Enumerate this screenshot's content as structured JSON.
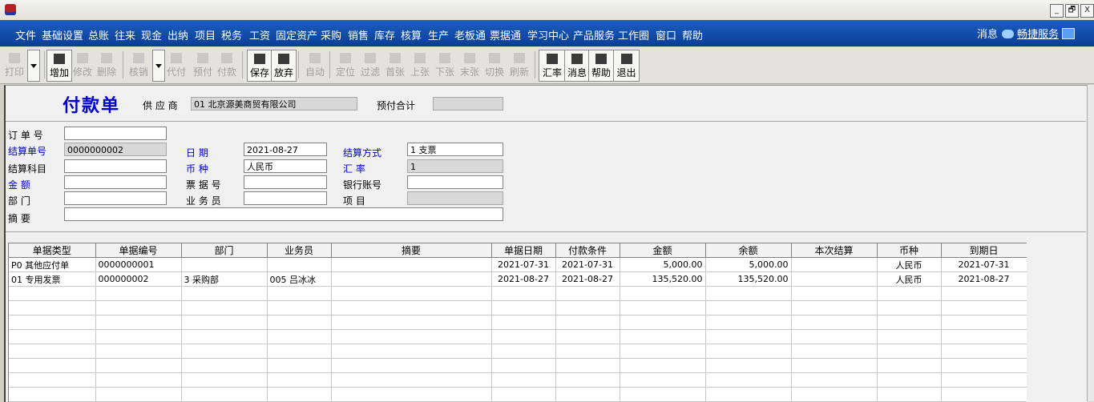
{
  "window": {
    "controls": [
      "_",
      "🗗",
      "X"
    ]
  },
  "menu": {
    "items": [
      "文件",
      "基础设置",
      "总账",
      "往来",
      "现金",
      "出纳",
      "项目",
      "税务",
      "工资",
      "固定资产",
      "采购",
      "销售",
      "库存",
      "核算",
      "生产",
      "老板通",
      "票据通",
      "学习中心",
      "产品服务",
      "工作圈",
      "窗口",
      "帮助"
    ],
    "messages": "消息",
    "service": "畅捷服务"
  },
  "toolbar": [
    {
      "label": "打印",
      "icon": "printer-icon",
      "enabled": false
    },
    {
      "label": "增加",
      "icon": "add-doc-icon",
      "enabled": true
    },
    {
      "label": "修改",
      "icon": "edit-icon",
      "enabled": false
    },
    {
      "label": "删除",
      "icon": "delete-x-icon",
      "enabled": false
    },
    {
      "label": "核销",
      "icon": "verify-icon",
      "enabled": false
    },
    {
      "label": "代付",
      "icon": "proxy-pay-icon",
      "enabled": false
    },
    {
      "label": "预付",
      "icon": "prepay-icon",
      "enabled": false
    },
    {
      "label": "付款",
      "icon": "pay-icon",
      "enabled": false
    },
    {
      "label": "保存",
      "icon": "save-disk-icon",
      "enabled": true
    },
    {
      "label": "放弃",
      "icon": "discard-icon",
      "enabled": true
    },
    {
      "label": "自动",
      "icon": "auto-icon",
      "enabled": false
    },
    {
      "label": "定位",
      "icon": "locate-icon",
      "enabled": false
    },
    {
      "label": "过滤",
      "icon": "filter-funnel-icon",
      "enabled": false
    },
    {
      "label": "首张",
      "icon": "first-icon",
      "enabled": false
    },
    {
      "label": "上张",
      "icon": "prev-icon",
      "enabled": false
    },
    {
      "label": "下张",
      "icon": "next-icon",
      "enabled": false
    },
    {
      "label": "末张",
      "icon": "last-icon",
      "enabled": false
    },
    {
      "label": "切换",
      "icon": "switch-icon",
      "enabled": false
    },
    {
      "label": "刷新",
      "icon": "refresh-icon",
      "enabled": false
    },
    {
      "label": "汇率",
      "icon": "exchange-rate-icon",
      "enabled": true
    },
    {
      "label": "消息",
      "icon": "message-icon",
      "enabled": true
    },
    {
      "label": "帮助",
      "icon": "help-icon",
      "enabled": true
    },
    {
      "label": "退出",
      "icon": "exit-icon",
      "enabled": true
    }
  ],
  "form": {
    "title": "付款单",
    "supplier_label": "供 应 商",
    "supplier_value": "01  北京源美商贸有限公司",
    "prepay_total_label": "预付合计",
    "prepay_total_value": "",
    "order_no_label": "订 单 号",
    "order_no_value": "",
    "settle_no_label": "结算单号",
    "settle_no_value": "0000000002",
    "date_label": "日    期",
    "date_value": "2021-08-27",
    "settle_method_label": "结算方式",
    "settle_method_value": "1  支票",
    "settle_subject_label": "结算科目",
    "settle_subject_value": "",
    "currency_label": "币    种",
    "currency_value": "人民币",
    "rate_label": "汇    率",
    "rate_value": "1",
    "amount_label": "金    额",
    "amount_value": "",
    "bill_no_label": "票 据 号",
    "bill_no_value": "",
    "bank_account_label": "银行账号",
    "bank_account_value": "",
    "dept_label": "部    门",
    "dept_value": "",
    "salesman_label": "业 务 员",
    "salesman_value": "",
    "project_label": "项    目",
    "project_value": "",
    "summary_label": "摘    要",
    "summary_value": ""
  },
  "grid": {
    "columns": [
      "单据类型",
      "单据编号",
      "部门",
      "业务员",
      "摘要",
      "单据日期",
      "付款条件",
      "金额",
      "余额",
      "本次结算",
      "币种",
      "到期日"
    ],
    "rows": [
      [
        "P0  其他应付单",
        "0000000001",
        "",
        "",
        "",
        "2021-07-31",
        "2021-07-31",
        "5,000.00",
        "5,000.00",
        "",
        "人民币",
        "2021-07-31"
      ],
      [
        "01  专用发票",
        "000000002",
        "3  采购部",
        "005  吕冰冰",
        "",
        "2021-08-27",
        "2021-08-27",
        "135,520.00",
        "135,520.00",
        "",
        "人民币",
        "2021-08-27"
      ]
    ],
    "empty_rows": 8
  },
  "colors": {
    "menu_bg": "#0a3d96",
    "title_blue": "#0000cc"
  }
}
